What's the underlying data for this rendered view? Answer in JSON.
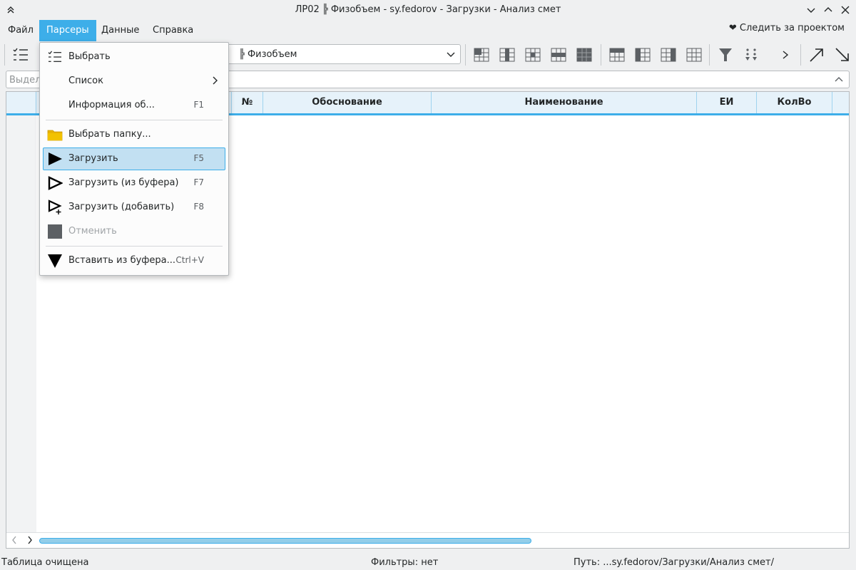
{
  "window": {
    "title": "ЛР02 ╠ Физобъем - sy.fedorov - Загрузки - Анализ смет"
  },
  "menubar": {
    "items": [
      {
        "label": "Файл"
      },
      {
        "label": "Парсеры"
      },
      {
        "label": "Данные"
      },
      {
        "label": "Справка"
      }
    ],
    "follow": "❤ Следить за проектом"
  },
  "toolbar": {
    "combo_value": "╠ Физобъем"
  },
  "search": {
    "placeholder": "Выдел"
  },
  "table": {
    "columns": [
      {
        "label": "№"
      },
      {
        "label": "Обоснование"
      },
      {
        "label": "Наименование"
      },
      {
        "label": "ЕИ"
      },
      {
        "label": "КолВо"
      }
    ]
  },
  "dropdown": {
    "items": [
      {
        "label": "Выбрать",
        "shortcut": ""
      },
      {
        "label": "Список",
        "shortcut": ""
      },
      {
        "label": "Информация об...",
        "shortcut": "F1"
      },
      {
        "label": "Выбрать папку...",
        "shortcut": ""
      },
      {
        "label": "Загрузить",
        "shortcut": "F5"
      },
      {
        "label": "Загрузить (из буфера)",
        "shortcut": "F7"
      },
      {
        "label": "Загрузить (добавить)",
        "shortcut": "F8"
      },
      {
        "label": "Отменить",
        "shortcut": ""
      },
      {
        "label": "Вставить из буфера...",
        "shortcut": "Ctrl+V"
      }
    ]
  },
  "statusbar": {
    "left": "Таблица очищена",
    "center": "Фильтры: нет",
    "right": "Путь: ...sy.fedorov/Загрузки/Анализ смет/"
  },
  "colors": {
    "accent": "#3daee9",
    "highlight": "#c2e0f2",
    "folder": "#e8b300"
  }
}
